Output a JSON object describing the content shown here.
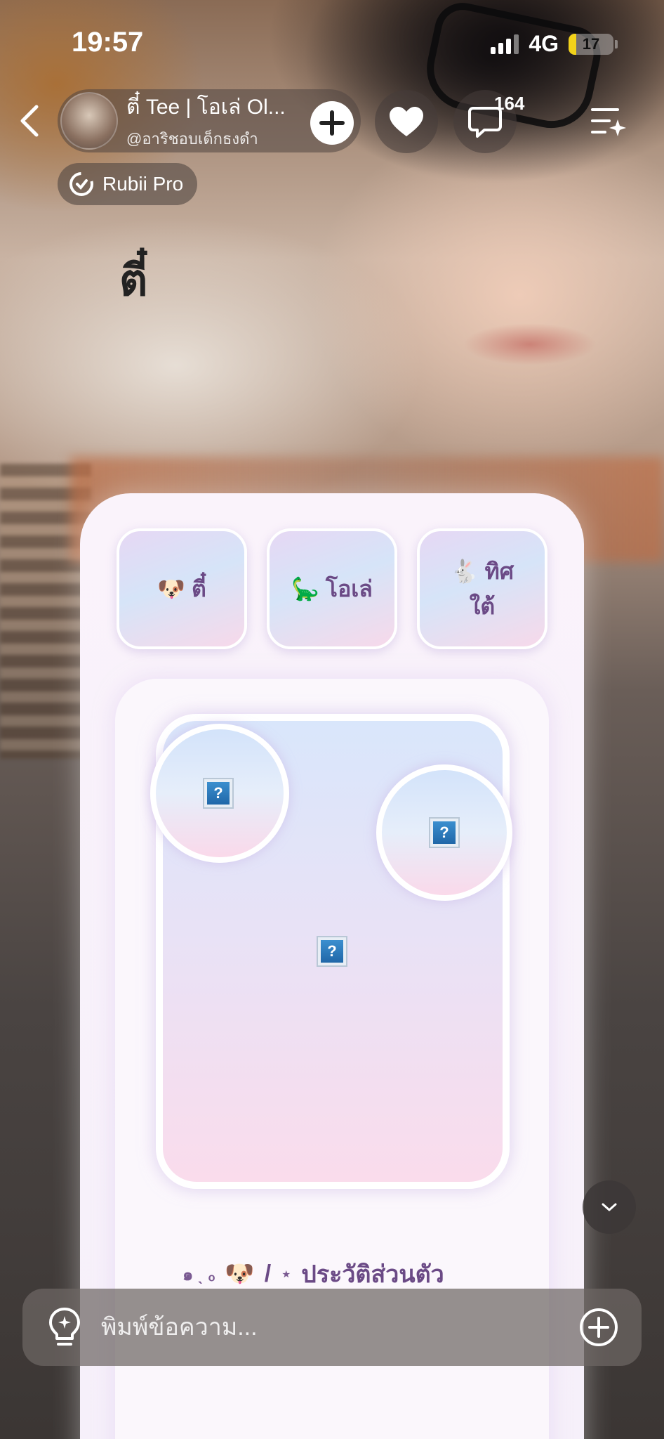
{
  "status_bar": {
    "time": "19:57",
    "network": "4G",
    "battery_level": "17",
    "battery_fraction": 0.17
  },
  "header": {
    "character_name": "ตี๋ Tee | โอเล่ Ol...",
    "character_handle": "@อาริชอบเด็กธงดำ",
    "comment_count": "164",
    "badge_label": "Rubii Pro"
  },
  "background_text": "ตี๋",
  "tabs": [
    {
      "emoji": "🐶",
      "label": "ตี๋"
    },
    {
      "emoji": "🦕",
      "label": "โอเล่"
    },
    {
      "emoji": "🐇",
      "label": "ทิศใต้"
    }
  ],
  "profile_section": {
    "prefix": "๑ ˎ ₒ",
    "emoji": "🐶",
    "separator": "/",
    "star": "⋆",
    "label": "ประวัติส่วนตัว"
  },
  "composer": {
    "placeholder": "พิมพ์ข้อความ..."
  },
  "colors": {
    "tab_text": "#6b4a86",
    "battery": "#f2d21a"
  }
}
